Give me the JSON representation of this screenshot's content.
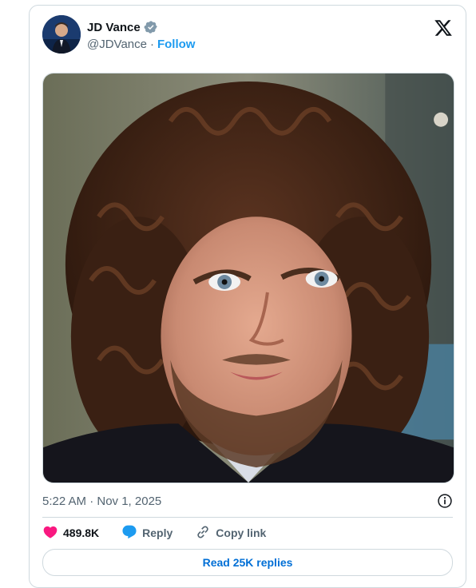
{
  "tweet": {
    "author": {
      "name": "JD Vance",
      "handle": "@JDVance",
      "separator": "·",
      "follow_label": "Follow",
      "verified_icon": "verified-badge-icon"
    },
    "photo": {
      "icon": "photo-image"
    },
    "timestamp": "5:22 AM · Nov 1, 2025",
    "actions": {
      "likes": "489.8K",
      "reply_label": "Reply",
      "copy_link_label": "Copy link"
    },
    "read_replies_label": "Read 25K replies"
  },
  "colors": {
    "accent": "#1d9bf0",
    "like": "#f91880",
    "link": "#006fd6",
    "border": "#cfd9de",
    "muted": "#536471"
  }
}
